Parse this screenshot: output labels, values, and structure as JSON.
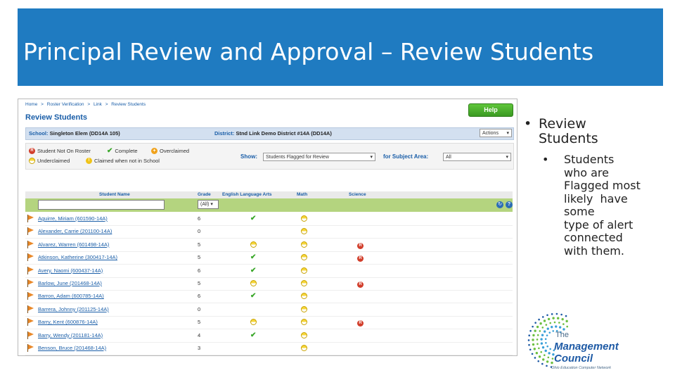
{
  "slide": {
    "title": "Principal Review and Approval – Review Students",
    "bullet1": "Review Students",
    "bullet2": "Students\nwho are\nFlagged most\nlikely  have\nsome\ntype of alert\nconnected\nwith them."
  },
  "app": {
    "breadcrumb": [
      "Home",
      ">",
      "Roster Verification",
      ">",
      "Link",
      ">",
      "Review Students"
    ],
    "help_label": "Help",
    "page_title": "Review Students",
    "school_label": "School:",
    "school_value": "Singleton Elem (DD14A 105)",
    "district_label": "District:",
    "district_value": "Stnd Link Demo District #14A (DD14A)",
    "actions_label": "Actions",
    "legend": {
      "not_on_roster": "Student Not On Roster",
      "complete": "Complete",
      "overclaimed": "Overclaimed",
      "underclaimed": "Underclaimed",
      "claimed_not_in_school": "Claimed when not in School"
    },
    "show_label": "Show:",
    "show_value": "Students Flagged for Review",
    "subject_label": "for  Subject Area:",
    "subject_value": "All",
    "columns": [
      "Student Name",
      "Grade",
      "English Language Arts",
      "Math",
      "Science"
    ],
    "grade_filter": "(All)",
    "rows": [
      {
        "name": "Aguirre, Miriam (601590-14A)",
        "grade": "6",
        "ela": "check",
        "math": "under",
        "sci": ""
      },
      {
        "name": "Alexander, Carrie (201100-14A)",
        "grade": "0",
        "ela": "",
        "math": "under",
        "sci": ""
      },
      {
        "name": "Alvarez, Warren (601498-14A)",
        "grade": "5",
        "ela": "under",
        "math": "under",
        "sci": "roster"
      },
      {
        "name": "Atkinson, Katherine (300417-14A)",
        "grade": "5",
        "ela": "check",
        "math": "under",
        "sci": "roster"
      },
      {
        "name": "Avery, Naomi (600437-14A)",
        "grade": "6",
        "ela": "check",
        "math": "under",
        "sci": ""
      },
      {
        "name": "Barlow, June (201468-14A)",
        "grade": "5",
        "ela": "under",
        "math": "under",
        "sci": "roster"
      },
      {
        "name": "Barron, Adam (600785-14A)",
        "grade": "6",
        "ela": "check",
        "math": "under",
        "sci": ""
      },
      {
        "name": "Barrera, Johnny (201125-14A)",
        "grade": "0",
        "ela": "",
        "math": "under",
        "sci": ""
      },
      {
        "name": "Barry, Kent (600876-14A)",
        "grade": "5",
        "ela": "under",
        "math": "under",
        "sci": "roster"
      },
      {
        "name": "Barry, Wendy (201181-14A)",
        "grade": "4",
        "ela": "check",
        "math": "under",
        "sci": ""
      },
      {
        "name": "Benson, Bruce (201468-14A)",
        "grade": "3",
        "ela": "",
        "math": "under",
        "sci": ""
      }
    ]
  },
  "logo": {
    "line1": "The",
    "line2": "Management",
    "line3": "Council",
    "line4": "Ohio Education Computer Network"
  },
  "colors": {
    "title_band": "#1f7bc1",
    "header_band": "#b4d47f",
    "link": "#1a5ea8"
  }
}
